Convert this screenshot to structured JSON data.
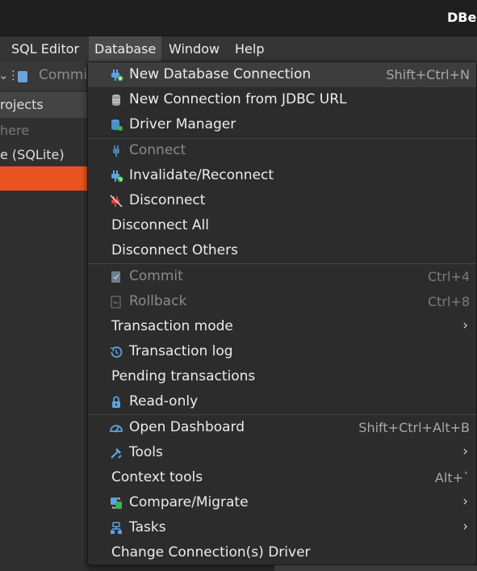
{
  "app": {
    "title": "DBe"
  },
  "menubar": {
    "items": [
      {
        "label": "SQL Editor"
      },
      {
        "label": "Database"
      },
      {
        "label": "Window"
      },
      {
        "label": "Help"
      }
    ]
  },
  "left_pane": {
    "toolbar_commit": "Commit",
    "tab_label": "rojects",
    "filter_placeholder": "here",
    "tree_item": "e (SQLite)"
  },
  "database_menu": {
    "items": [
      {
        "label": "New Database Connection",
        "shortcut": "Shift+Ctrl+N",
        "icon": "new-connection-icon"
      },
      {
        "label": "New Connection from JDBC URL",
        "icon": "database-stack-icon"
      },
      {
        "label": "Driver Manager",
        "icon": "driver-manager-icon"
      },
      {
        "label": "Connect",
        "icon": "plug-icon"
      },
      {
        "label": "Invalidate/Reconnect",
        "icon": "reconnect-icon"
      },
      {
        "label": "Disconnect",
        "icon": "disconnect-icon"
      },
      {
        "label": "Disconnect All"
      },
      {
        "label": "Disconnect Others"
      },
      {
        "label": "Commit",
        "shortcut": "Ctrl+4",
        "icon": "commit-icon"
      },
      {
        "label": "Rollback",
        "shortcut": "Ctrl+8",
        "icon": "rollback-icon"
      },
      {
        "label": "Transaction mode",
        "submenu": "›"
      },
      {
        "label": "Transaction log",
        "icon": "history-icon"
      },
      {
        "label": "Pending transactions"
      },
      {
        "label": "Read-only",
        "icon": "lock-icon"
      },
      {
        "label": "Open Dashboard",
        "shortcut": "Shift+Ctrl+Alt+B",
        "icon": "dashboard-icon"
      },
      {
        "label": "Tools",
        "submenu": "›",
        "icon": "tools-icon"
      },
      {
        "label": "Context tools",
        "shortcut": "Alt+`"
      },
      {
        "label": "Compare/Migrate",
        "submenu": "›",
        "icon": "compare-icon"
      },
      {
        "label": "Tasks",
        "submenu": "›",
        "icon": "tasks-icon"
      },
      {
        "label": "Change Connection(s) Driver"
      }
    ]
  },
  "colors": {
    "accent_orange": "#e95420",
    "menu_bg": "#2c2c2c",
    "highlight_bg": "#3d3d3d"
  }
}
